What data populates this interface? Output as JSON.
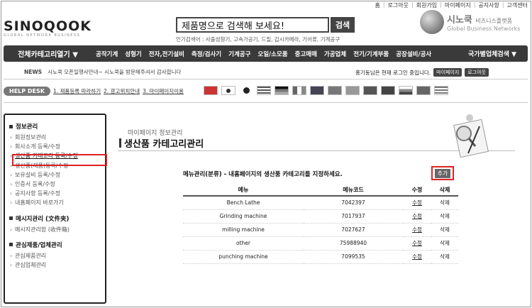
{
  "util_links": [
    "홈",
    "로그아웃",
    "회원가입",
    "마이페이지",
    "공지사항",
    "고객센터"
  ],
  "logo": {
    "name": "SINOQOOK",
    "tagline": "GLOBAL NETWORK BUSINESS"
  },
  "search": {
    "placeholder": "제품명으로 검색해 보세요!",
    "button": "검색",
    "popular": "인기검색어 : 사출성형기, 고속가공기, 드릴, 갑시카메라, 기어류, 기계공구"
  },
  "brand": {
    "korean": "시노쿡",
    "korean_sub": "비즈니스플랫폼",
    "english": "Global Business Networks"
  },
  "nav": {
    "all_categories": "전체카테고리열기 ▼",
    "items": [
      "공작기계",
      "성형기",
      "전자,전기설비",
      "측정/검사기",
      "기계공구",
      "오일/소모품",
      "중고매매",
      "가공업체",
      "전기/기계부품",
      "공장설비/공사"
    ],
    "country": "국가별업체검색 ▼"
  },
  "news": {
    "label": "NEWS",
    "text": "시노쿡 오픈일행사안내~ 시노쿡을 방문해주셔서 감사합니다"
  },
  "login": {
    "text": "홍기동님은 현재 로그인 중입니다.",
    "mypage": "마이페이지",
    "logout": "로그아웃"
  },
  "help": {
    "badge": "HELP DESK",
    "steps": [
      "1. 제품등록 따라하기",
      "2. 광고위치안내",
      "3. 마이페이지이용"
    ]
  },
  "flags": [
    "cn",
    "kr",
    "jp",
    "us",
    "de",
    "it",
    "uk",
    "hk",
    "in",
    "tw",
    "sg",
    "ru",
    "br",
    "gr"
  ],
  "sidebar": {
    "sections": [
      {
        "title": "정보관리",
        "items": [
          "회원정보관리",
          "회사소개 등록/수정",
          "생산품 카테고리 등록/수정",
          "생산품(제품)등록/수정",
          "보유설비 등록/수정",
          "인증서 등록/수정",
          "공지사항 등록/수정",
          "내홈페이지 바로가기"
        ]
      },
      {
        "title": "메시지관리 (文件夹)",
        "items": [
          "메시지관리함 (收件箱)"
        ]
      },
      {
        "title": "관심제품/업체관리",
        "items": [
          "관심제품관리",
          "관심업체관리"
        ]
      }
    ]
  },
  "main": {
    "breadcrumb": "마이페이지 정보관리",
    "title": "생산품 카테고리관리",
    "description": "메뉴관리(분류) - 내홈페이지의 생산품 카테고리를 지정하세요.",
    "add_button": "추가",
    "table": {
      "headers": [
        "메뉴",
        "메뉴코드",
        "수정",
        "삭제"
      ],
      "rows": [
        {
          "menu": "Bench Lathe",
          "code": "7042397",
          "edit": "수정",
          "delete": "삭제"
        },
        {
          "menu": "Grinding machine",
          "code": "7017937",
          "edit": "수정",
          "delete": "삭제"
        },
        {
          "menu": "milling machine",
          "code": "7027627",
          "edit": "수정",
          "delete": "삭제"
        },
        {
          "menu": "other",
          "code": "75988940",
          "edit": "수정",
          "delete": "삭제"
        },
        {
          "menu": "punching machine",
          "code": "7099535",
          "edit": "수정",
          "delete": "삭제"
        }
      ]
    }
  }
}
